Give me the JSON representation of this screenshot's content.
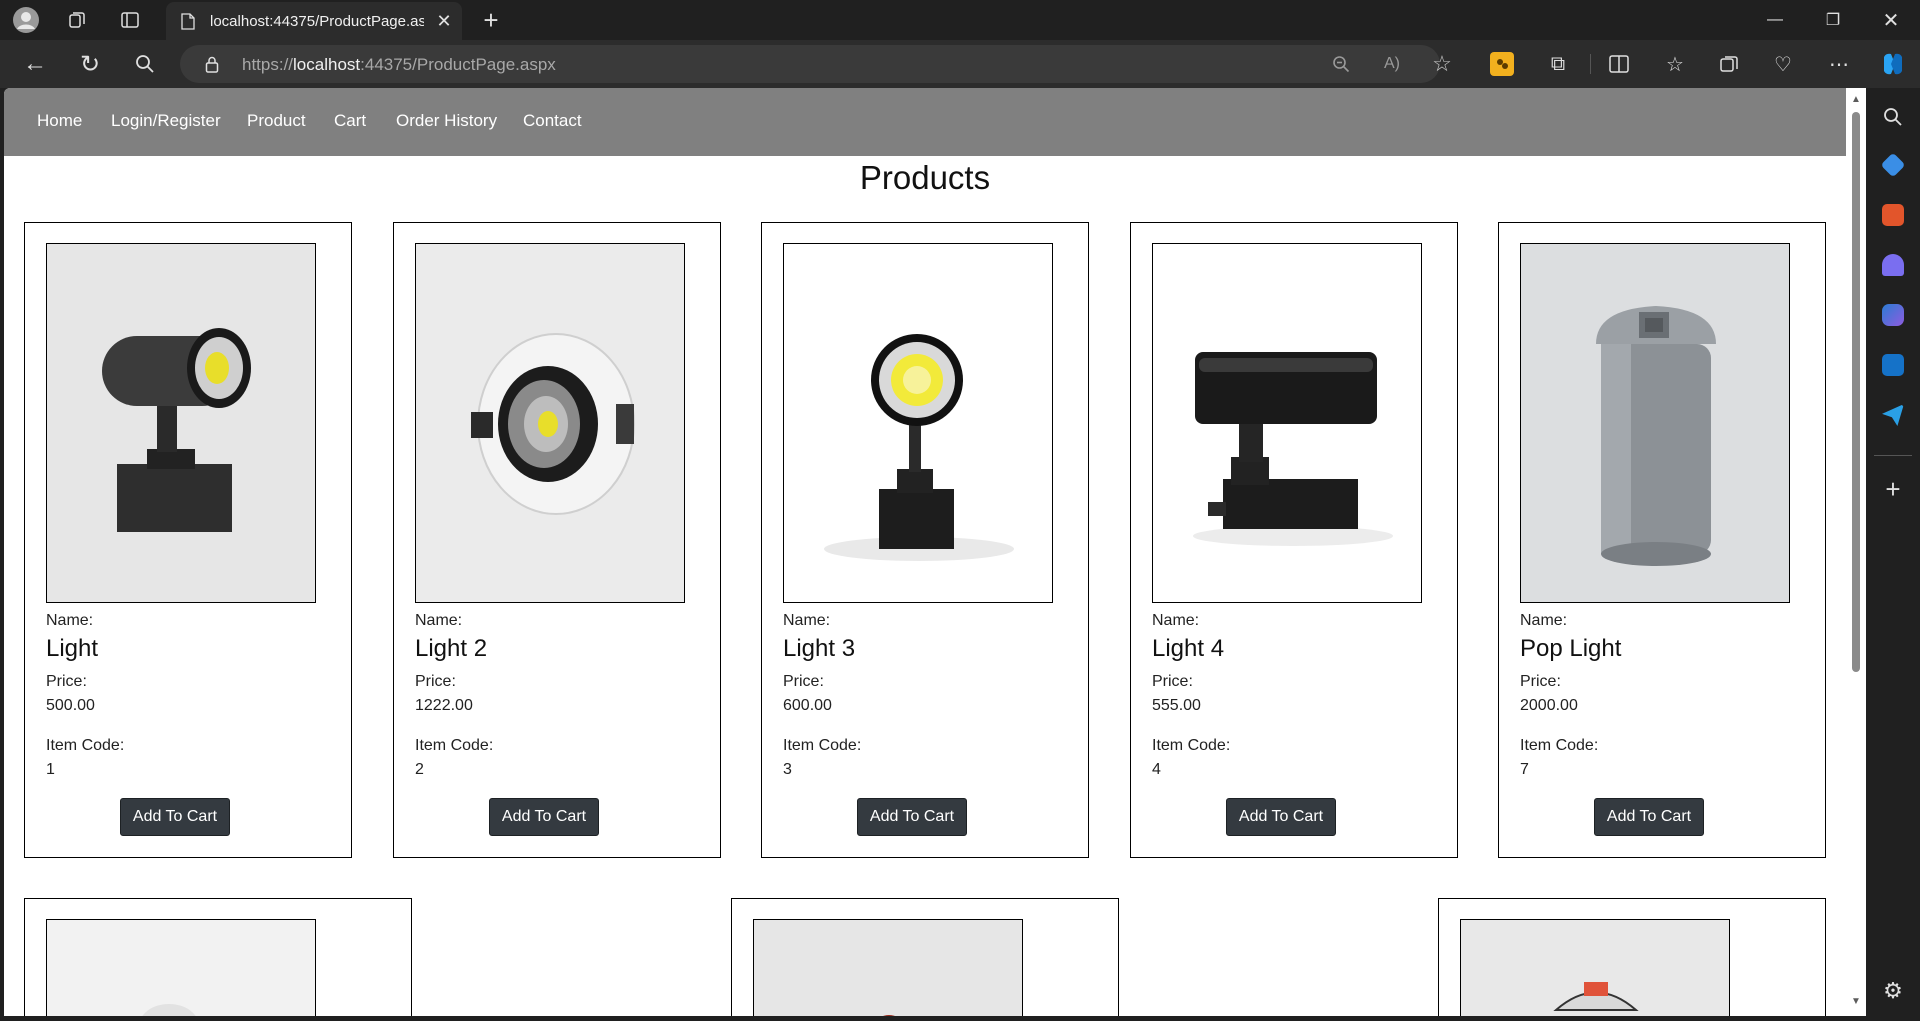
{
  "browser": {
    "tab_title": "localhost:44375/ProductPage.aspx",
    "url_prefix": "https://",
    "url_host": "localhost",
    "url_rest": ":44375/ProductPage.aspx"
  },
  "nav": {
    "items": [
      "Home",
      "Login/Register",
      "Product",
      "Cart",
      "Order History",
      "Contact"
    ]
  },
  "page": {
    "heading": "Products"
  },
  "labels": {
    "name": "Name:",
    "price": "Price:",
    "item_code": "Item Code:",
    "add_to_cart": "Add To Cart"
  },
  "products": [
    {
      "name": "Light",
      "price": "500.00",
      "code": "1"
    },
    {
      "name": "Light 2",
      "price": "1222.00",
      "code": "2"
    },
    {
      "name": "Light 3",
      "price": "600.00",
      "code": "3"
    },
    {
      "name": "Light 4",
      "price": "555.00",
      "code": "4"
    },
    {
      "name": "Pop Light",
      "price": "2000.00",
      "code": "7"
    }
  ],
  "colors": {
    "nav_bg": "#808080",
    "button_bg": "#343a40",
    "chrome_bg": "#202020"
  }
}
